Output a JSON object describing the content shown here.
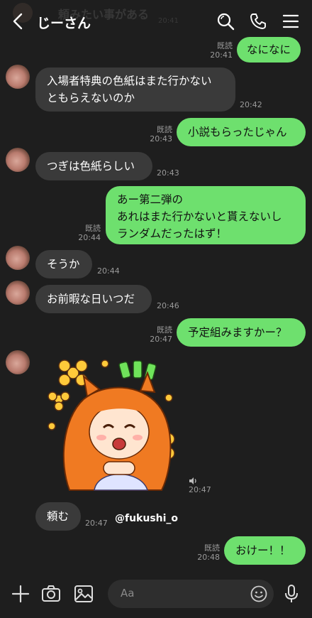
{
  "header": {
    "title": "じーさん",
    "ghost_preview": "頼みたい事がある",
    "ghost_time": "20:41"
  },
  "messages": [
    {
      "dir": "out",
      "lines": [
        "なになに"
      ],
      "read": "既読",
      "time": "20:41"
    },
    {
      "dir": "in",
      "lines": [
        "入場者特典の色紙はまた行かない",
        "ともらえないのか"
      ],
      "time": "20:42"
    },
    {
      "dir": "out",
      "lines": [
        "小説もらったじゃん"
      ],
      "read": "既読",
      "time": "20:43"
    },
    {
      "dir": "in",
      "lines": [
        "つぎは色紙らしい"
      ],
      "time": "20:43"
    },
    {
      "dir": "out",
      "lines": [
        "あー第二弾の",
        "あれはまた行かないと貰えないし",
        "ランダムだったはず！"
      ],
      "read": "既読",
      "time": "20:44"
    },
    {
      "dir": "in",
      "lines": [
        "そうか"
      ],
      "time": "20:44"
    },
    {
      "dir": "in",
      "lines": [
        "お前暇な日いつだ"
      ],
      "time": "20:46"
    },
    {
      "dir": "out",
      "lines": [
        "予定組みますかー？"
      ],
      "read": "既読",
      "time": "20:47"
    },
    {
      "dir": "in",
      "type": "sticker",
      "time": "20:47",
      "sound_icon": "speaker-icon"
    },
    {
      "dir": "in",
      "lines": [
        "頼む"
      ],
      "time": "20:47"
    },
    {
      "dir": "out",
      "lines": [
        "おけー！！"
      ],
      "read": "既読",
      "time": "20:48"
    }
  ],
  "watermark": "@fukushi_o",
  "input": {
    "placeholder": "Aa"
  },
  "colors": {
    "background": "#1e1e1e",
    "outgoing_bubble": "#6ee06e",
    "incoming_bubble": "#3a3a3a",
    "meta_text": "#9a9a9a"
  },
  "icons": [
    "back-icon",
    "search-icon",
    "phone-icon",
    "menu-icon",
    "plus-icon",
    "camera-icon",
    "image-icon",
    "emoji-icon",
    "mic-icon",
    "speaker-icon"
  ]
}
